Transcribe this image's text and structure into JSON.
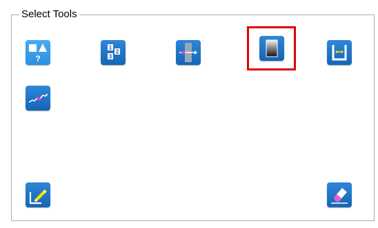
{
  "panel": {
    "title": "Select Tools"
  },
  "tools": [
    {
      "id": "shape-detection",
      "icon": "shapes-question-icon"
    },
    {
      "id": "numbering",
      "icon": "numbered-squares-icon"
    },
    {
      "id": "width-measure",
      "icon": "horizontal-arrow-bar-icon"
    },
    {
      "id": "gradient",
      "icon": "gradient-rect-icon",
      "selected": true
    },
    {
      "id": "inner-width",
      "icon": "u-bracket-arrow-icon"
    },
    {
      "id": "profile-line",
      "icon": "profile-line-icon"
    },
    {
      "id": "edit",
      "icon": "pencil-edit-icon"
    },
    {
      "id": "erase",
      "icon": "eraser-icon"
    }
  ],
  "colors": {
    "tile": "#1e72c4",
    "tile_light": "#3aa0ea",
    "selection": "#e10000",
    "accent_magenta": "#e040c0",
    "accent_yellow": "#f5e600"
  }
}
